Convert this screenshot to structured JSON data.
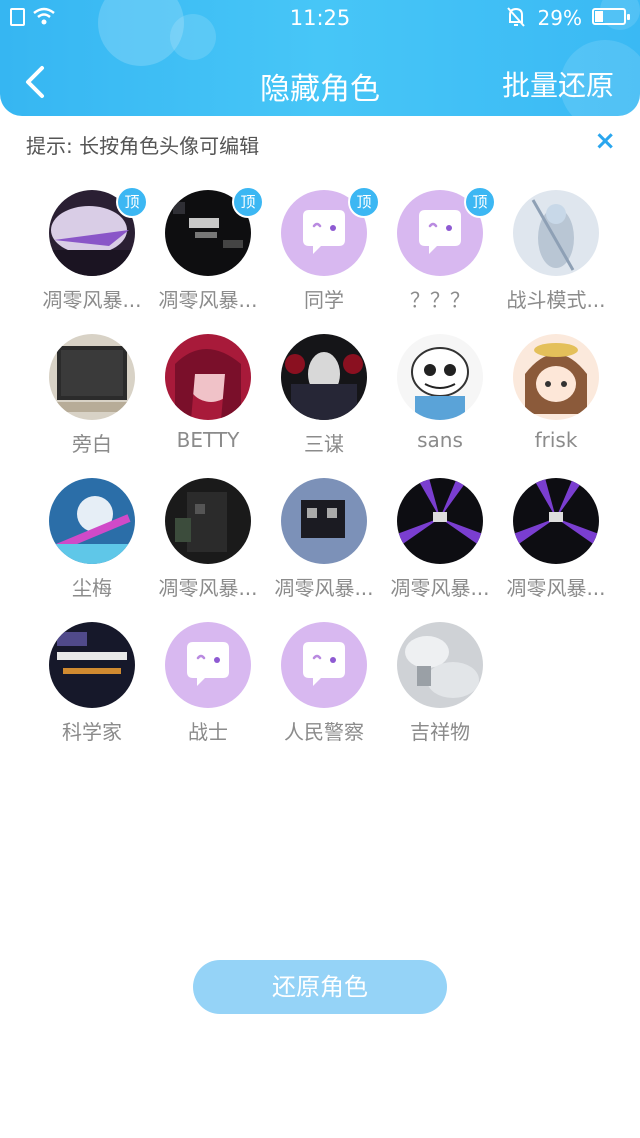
{
  "status_bar": {
    "time": "11:25",
    "battery_percent": "29%",
    "battery_level": 0.29
  },
  "header": {
    "title": "隐藏角色",
    "batch_restore_label": "批量还原"
  },
  "tip": {
    "text": "提示: 长按角色头像可编辑",
    "close_label": "×"
  },
  "characters": [
    {
      "name": "凋零风暴...",
      "badge": "顶",
      "avatar": "photo-dark-purple"
    },
    {
      "name": "凋零风暴...",
      "badge": "顶",
      "avatar": "photo-dark-minecraft"
    },
    {
      "name": "同学",
      "badge": "顶",
      "avatar": "default-chat-bubble"
    },
    {
      "name": "？？？",
      "badge": "顶",
      "avatar": "default-chat-bubble"
    },
    {
      "name": "战斗模式...",
      "badge": "",
      "avatar": "photo-anime-light"
    },
    {
      "name": "旁白",
      "badge": "",
      "avatar": "photo-screen"
    },
    {
      "name": "BETTY",
      "badge": "",
      "avatar": "photo-anime-pink"
    },
    {
      "name": "三谋",
      "badge": "",
      "avatar": "photo-dark-red"
    },
    {
      "name": "sans",
      "badge": "",
      "avatar": "photo-sans-skull"
    },
    {
      "name": "frisk",
      "badge": "",
      "avatar": "photo-anime-brown"
    },
    {
      "name": "尘梅",
      "badge": "",
      "avatar": "photo-anime-blue"
    },
    {
      "name": "凋零风暴...",
      "badge": "",
      "avatar": "photo-minecraft-dark"
    },
    {
      "name": "凋零风暴...",
      "badge": "",
      "avatar": "photo-minecraft-sky"
    },
    {
      "name": "凋零风暴...",
      "badge": "",
      "avatar": "photo-purple-beams"
    },
    {
      "name": "凋零风暴...",
      "badge": "",
      "avatar": "photo-purple-beams"
    },
    {
      "name": "科学家",
      "badge": "",
      "avatar": "photo-text-screen"
    },
    {
      "name": "战士",
      "badge": "",
      "avatar": "default-chat-bubble"
    },
    {
      "name": "人民警察",
      "badge": "",
      "avatar": "default-chat-bubble"
    },
    {
      "name": "吉祥物",
      "badge": "",
      "avatar": "photo-grey-snow"
    }
  ],
  "restore_button": {
    "label": "还原角色"
  },
  "colors": {
    "header": "#36b6f2",
    "badge": "#3cb7f3",
    "default_avatar": "#d8b8f0",
    "restore_button": "#95d3f7",
    "close_icon": "#2aa6ee"
  }
}
